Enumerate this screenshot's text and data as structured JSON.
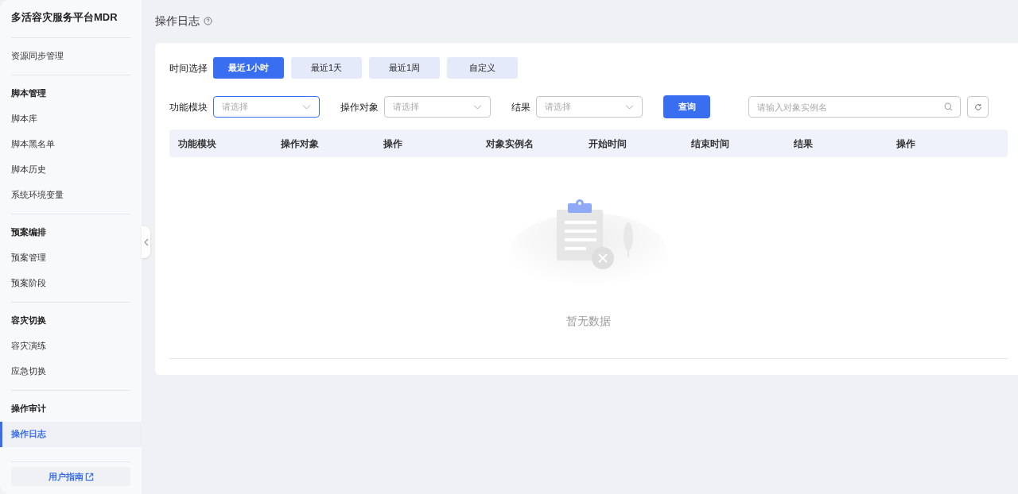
{
  "sidebar": {
    "title": "多活容灾服务平台MDR",
    "sections": [
      {
        "items": [
          {
            "label": "资源同步管理",
            "selected": false
          }
        ]
      },
      {
        "heading": "脚本管理",
        "items": [
          {
            "label": "脚本库",
            "selected": false
          },
          {
            "label": "脚本黑名单",
            "selected": false
          },
          {
            "label": "脚本历史",
            "selected": false
          },
          {
            "label": "系统环境变量",
            "selected": false
          }
        ]
      },
      {
        "heading": "预案编排",
        "items": [
          {
            "label": "预案管理",
            "selected": false
          },
          {
            "label": "预案阶段",
            "selected": false
          }
        ]
      },
      {
        "heading": "容灾切换",
        "items": [
          {
            "label": "容灾演练",
            "selected": false
          },
          {
            "label": "应急切换",
            "selected": false
          }
        ]
      },
      {
        "heading": "操作审计",
        "items": [
          {
            "label": "操作日志",
            "selected": true
          }
        ]
      }
    ],
    "guide": "用户指南"
  },
  "page_title": "操作日志",
  "time": {
    "label": "时间选择",
    "options": [
      {
        "label": "最近1小时",
        "selected": true
      },
      {
        "label": "最近1天",
        "selected": false
      },
      {
        "label": "最近1周",
        "selected": false
      },
      {
        "label": "自定义",
        "selected": false
      }
    ]
  },
  "filters": [
    {
      "label": "功能模块",
      "placeholder": "请选择",
      "focused": true
    },
    {
      "label": "操作对象",
      "placeholder": "请选择",
      "focused": false
    },
    {
      "label": "结果",
      "placeholder": "请选择",
      "focused": false
    }
  ],
  "query_button": "查询",
  "search": {
    "placeholder": "请输入对象实例名"
  },
  "table": {
    "columns": [
      "功能模块",
      "操作对象",
      "操作",
      "对象实例名",
      "开始时间",
      "结束时间",
      "结果",
      "操作"
    ],
    "empty_text": "暂无数据"
  }
}
